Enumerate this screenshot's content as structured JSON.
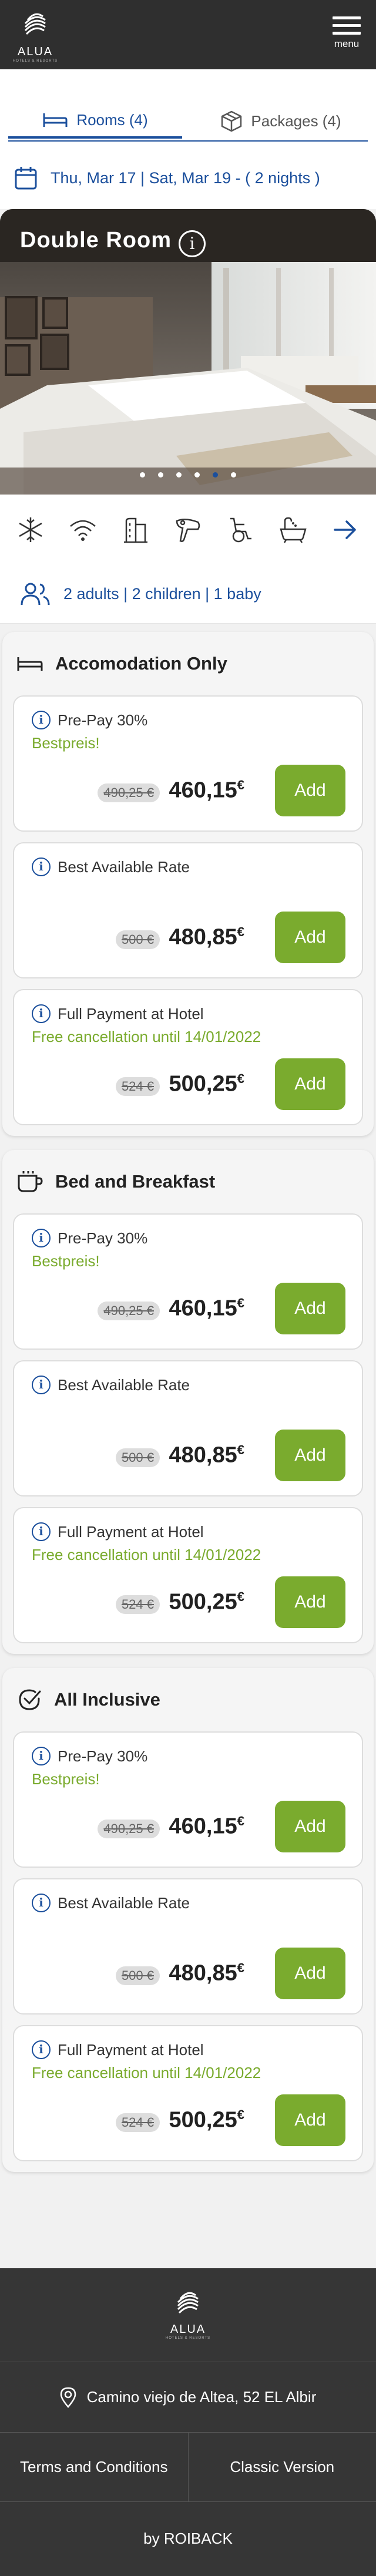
{
  "header": {
    "logo_text": "ALUA",
    "logo_sub": "HOTELS & RESORTS",
    "menu_label": "menu"
  },
  "tabs": [
    {
      "label": "Rooms (4)",
      "icon": "bed-icon"
    },
    {
      "label": "Packages (4)",
      "icon": "box-icon"
    }
  ],
  "dates": {
    "text": "Thu, Mar 17  |  Sat, Mar 19  - ( 2 nights )"
  },
  "room": {
    "title": "Double Room",
    "carousel_dots": 6,
    "active_dot": 4,
    "amenities": [
      "snowflake-icon",
      "wifi-icon",
      "building-icon",
      "hairdryer-icon",
      "wheelchair-icon",
      "bathtub-icon",
      "arrow-right-icon"
    ],
    "occupancy": "2 adults | 2 children | 1 baby"
  },
  "plans": [
    {
      "name": "Accomodation Only",
      "icon": "bed-icon",
      "rates": [
        {
          "name": "Pre-Pay 30%",
          "tag": "Bestpreis!",
          "old": "490,25 €",
          "new": "460,15",
          "cur": "€",
          "btn": "Add"
        },
        {
          "name": "Best Available Rate",
          "tag": "",
          "old": "500 €",
          "new": "480,85",
          "cur": "€",
          "btn": "Add"
        },
        {
          "name": "Full Payment at Hotel",
          "tag": "Free cancellation until 14/01/2022",
          "old": "524 €",
          "new": "500,25",
          "cur": "€",
          "btn": "Add"
        }
      ]
    },
    {
      "name": "Bed and Breakfast",
      "icon": "coffee-cup-icon",
      "rates": [
        {
          "name": "Pre-Pay 30%",
          "tag": "Bestpreis!",
          "old": "490,25 €",
          "new": "460,15",
          "cur": "€",
          "btn": "Add"
        },
        {
          "name": "Best Available Rate",
          "tag": "",
          "old": "500 €",
          "new": "480,85",
          "cur": "€",
          "btn": "Add"
        },
        {
          "name": "Full Payment at Hotel",
          "tag": "Free cancellation until 14/01/2022",
          "old": "524 €",
          "new": "500,25",
          "cur": "€",
          "btn": "Add"
        }
      ]
    },
    {
      "name": "All Inclusive",
      "icon": "check-circle-icon",
      "rates": [
        {
          "name": "Pre-Pay 30%",
          "tag": "Bestpreis!",
          "old": "490,25 €",
          "new": "460,15",
          "cur": "€",
          "btn": "Add"
        },
        {
          "name": "Best Available Rate",
          "tag": "",
          "old": "500 €",
          "new": "480,85",
          "cur": "€",
          "btn": "Add"
        },
        {
          "name": "Full Payment at Hotel",
          "tag": "Free cancellation until 14/01/2022",
          "old": "524 €",
          "new": "500,25",
          "cur": "€",
          "btn": "Add"
        }
      ]
    }
  ],
  "footer": {
    "logo_text": "ALUA",
    "logo_sub": "HOTELS & RESORTS",
    "address": "Camino viejo de Altea, 52 EL Albir",
    "links": [
      "Terms and Conditions",
      "Classic Version"
    ],
    "by": "by ROIBACK"
  },
  "colors": {
    "primary": "#1b4f9c",
    "accent_green": "#7aab2e",
    "header_bg": "#2f2f2f",
    "footer_bg": "#363636"
  }
}
